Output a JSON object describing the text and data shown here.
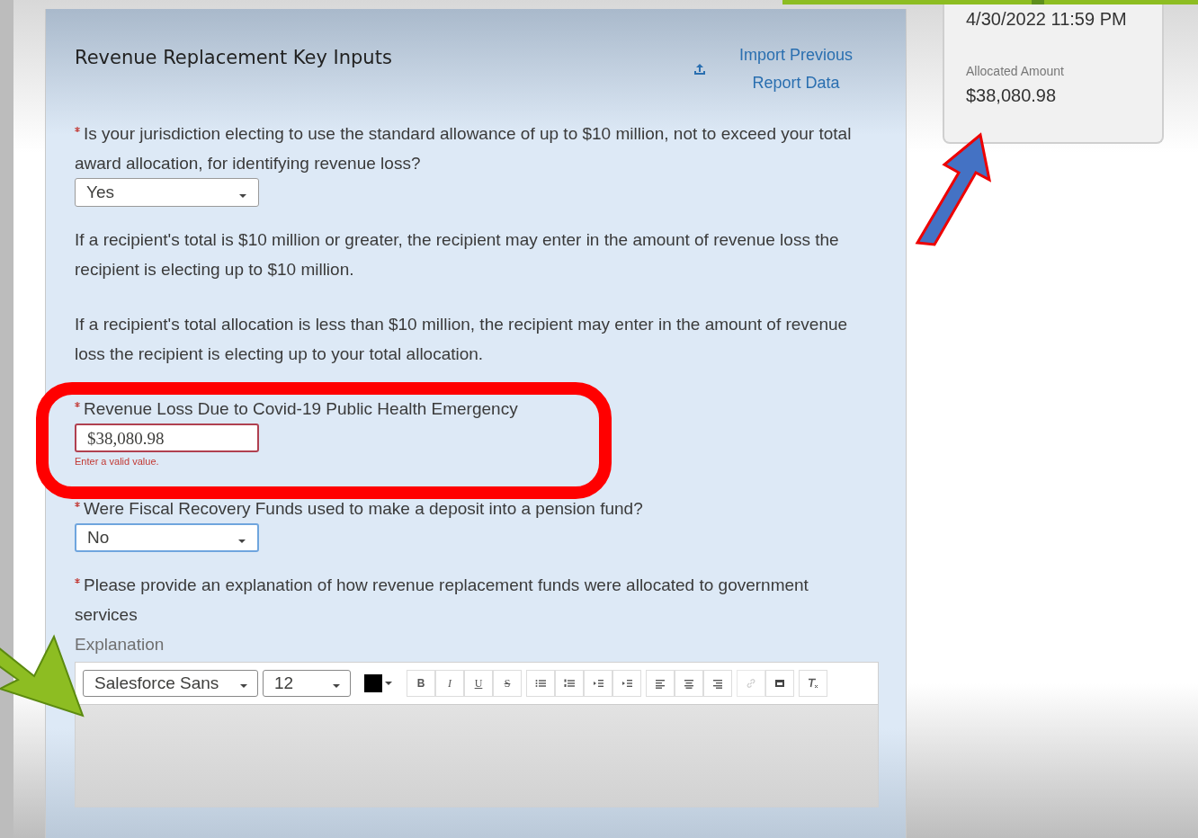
{
  "panel": {
    "title": "Revenue Replacement Key Inputs",
    "import_link": "Import Previous Report Data"
  },
  "summary_card": {
    "date": "4/30/2022 11:59 PM",
    "amount_label": "Allocated Amount",
    "amount": "$38,080.98"
  },
  "items": [
    {
      "kind": "select",
      "required": true,
      "label": "Is your jurisdiction electing to use the standard allowance of up to $10 million, not to exceed your total award allocation, for identifying revenue loss?",
      "value": "Yes",
      "focused": false
    },
    {
      "kind": "paragraph",
      "text": "If a recipient's total is $10 million or greater, the recipient may enter in the amount of revenue loss the recipient is electing up to $10 million."
    },
    {
      "kind": "paragraph",
      "text": "If a recipient's total allocation is less than $10 million, the recipient may enter in the amount of revenue loss the recipient is electing up to your total allocation."
    },
    {
      "kind": "input",
      "required": true,
      "label": "Revenue Loss Due to Covid-19 Public Health Emergency",
      "value": "$38,080.98",
      "error": "Enter a valid value."
    },
    {
      "kind": "select",
      "required": true,
      "label": "Were Fiscal Recovery Funds used to make a deposit into a pension fund?",
      "value": "No",
      "focused": true
    },
    {
      "kind": "richtext",
      "required": true,
      "label": "Please provide an explanation of how revenue replacement funds were allocated to government services",
      "sublabel": "Explanation",
      "font": "Salesforce Sans",
      "size": "12",
      "color": "#000000",
      "format_buttons": [
        "B",
        "I",
        "U",
        "S"
      ]
    }
  ]
}
